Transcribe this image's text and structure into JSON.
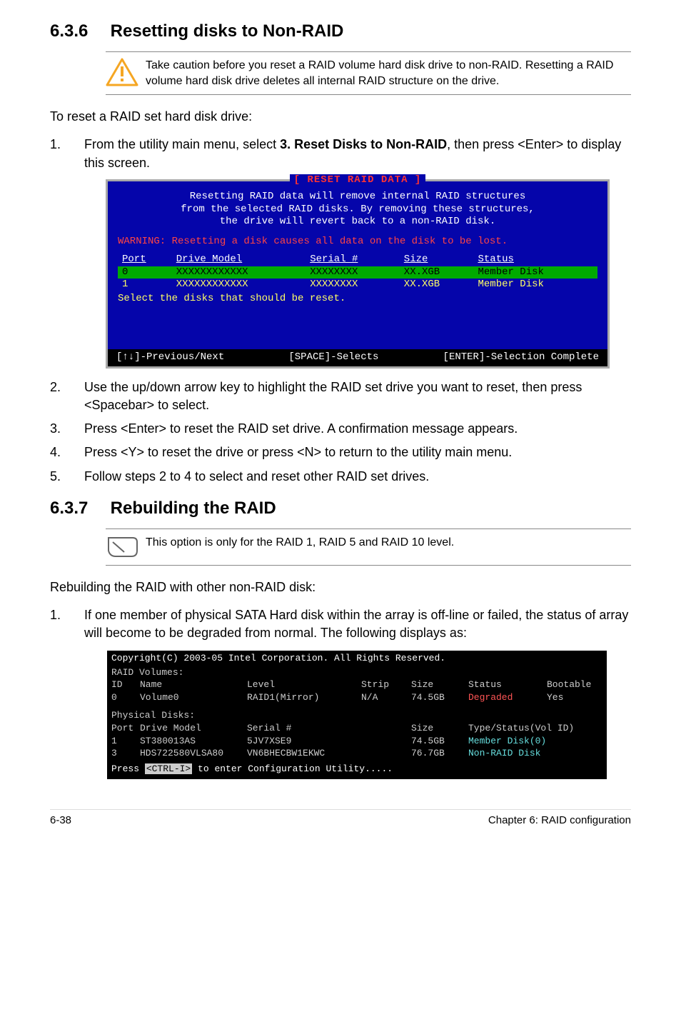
{
  "section1": {
    "number": "6.3.6",
    "title": "Resetting disks to Non-RAID",
    "caution": "Take caution before you reset a RAID volume hard disk drive to non-RAID. Resetting a RAID volume hard disk drive deletes all internal RAID structure on the drive.",
    "intro": "To reset a RAID set hard disk drive:",
    "step1_pre": "From the utility main menu, select ",
    "step1_bold": "3. Reset Disks to Non-RAID",
    "step1_post": ", then press <Enter> to display this screen.",
    "step2": "Use the up/down arrow key to highlight the RAID set drive you want to reset, then press <Spacebar> to select.",
    "step3": "Press <Enter> to reset the RAID set drive. A confirmation message appears.",
    "step4": "Press <Y> to reset the drive or press <N> to return to the utility main menu.",
    "step5": "Follow steps 2 to 4 to select and reset other RAID set drives."
  },
  "bios1": {
    "title": "[ RESET RAID DATA ]",
    "line1": "Resetting RAID data will remove internal RAID structures",
    "line2": "from the selected RAID disks. By removing these structures,",
    "line3": "the drive will revert back to a non-RAID disk.",
    "warning": "WARNING: Resetting a disk causes all data on the disk to be lost.",
    "col_port": "Port",
    "col_model": "Drive Model",
    "col_serial": "Serial #",
    "col_size": "Size",
    "col_status": "Status",
    "rows": [
      {
        "port": "0",
        "model": "XXXXXXXXXXXX",
        "serial": "XXXXXXXX",
        "size": "XX.XGB",
        "status": "Member Disk"
      },
      {
        "port": "1",
        "model": "XXXXXXXXXXXX",
        "serial": "XXXXXXXX",
        "size": "XX.XGB",
        "status": "Member Disk"
      }
    ],
    "select_line": "Select the disks that should be reset.",
    "foot_left": "[↑↓]-Previous/Next",
    "foot_mid": "[SPACE]-Selects",
    "foot_right": "[ENTER]-Selection Complete"
  },
  "section2": {
    "number": "6.3.7",
    "title": "Rebuilding the RAID",
    "note": "This option is only for the RAID 1, RAID 5 and RAID 10 level.",
    "intro": "Rebuilding the RAID with other non-RAID disk:",
    "step1": "If one member of physical SATA Hard disk within the array is off-line or failed, the status of array will become to be degraded from normal. The following displays as:"
  },
  "bios2": {
    "top": "Copyright(C) 2003-05 Intel Corporation.  All Rights Reserved.",
    "vol_header": "RAID Volumes:",
    "vol_cols": {
      "c1": "ID",
      "c2": "Name",
      "c3": "Level",
      "c4": "Strip",
      "c5": "Size",
      "c6": "Status",
      "c7": "Bootable"
    },
    "vol_row": {
      "c1": "0",
      "c2": "Volume0",
      "c3": "RAID1(Mirror)",
      "c4": "N/A",
      "c5": "74.5GB",
      "c6": "Degraded",
      "c7": "Yes"
    },
    "disk_header": "Physical Disks:",
    "disk_cols": {
      "c1": "Port",
      "c2": "Drive Model",
      "c3": "Serial #",
      "c4": "",
      "c5": "Size",
      "c6": "Type/Status(Vol ID)"
    },
    "disk_rows": [
      {
        "c1": "1",
        "c2": "ST380013AS",
        "c3": "5JV7XSE9",
        "c4": "",
        "c5": "74.5GB",
        "c6": "Member Disk(0)"
      },
      {
        "c1": "3",
        "c2": "HDS722580VLSA80",
        "c3": "VN6BHECBW1EKWC",
        "c4": "",
        "c5": "76.7GB",
        "c6": "Non-RAID Disk"
      }
    ],
    "press_pre": "Press ",
    "press_key": "<CTRL-I>",
    "press_post": " to enter Configuration Utility....."
  },
  "footer": {
    "left": "6-38",
    "right": "Chapter 6: RAID configuration"
  }
}
